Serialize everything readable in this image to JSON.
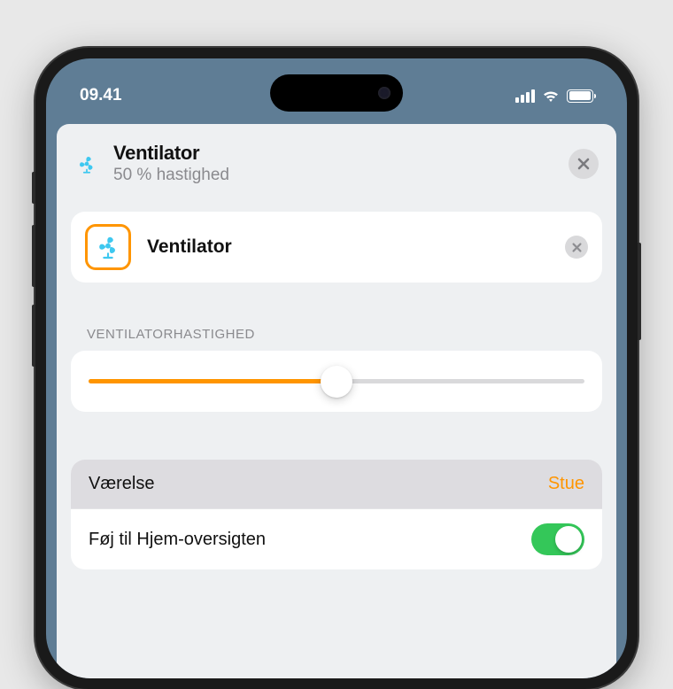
{
  "status": {
    "time": "09.41"
  },
  "header": {
    "title": "Ventilator",
    "subtitle": "50 % hastighed"
  },
  "accessory": {
    "name": "Ventilator"
  },
  "speed": {
    "section_label": "VENTILATORHASTIGHED",
    "percent": 50
  },
  "settings": {
    "room_label": "Værelse",
    "room_value": "Stue",
    "add_to_home_label": "Føj til Hjem-oversigten",
    "add_to_home_on": true
  },
  "colors": {
    "accent": "#ff9500",
    "toggle_on": "#34c759"
  }
}
